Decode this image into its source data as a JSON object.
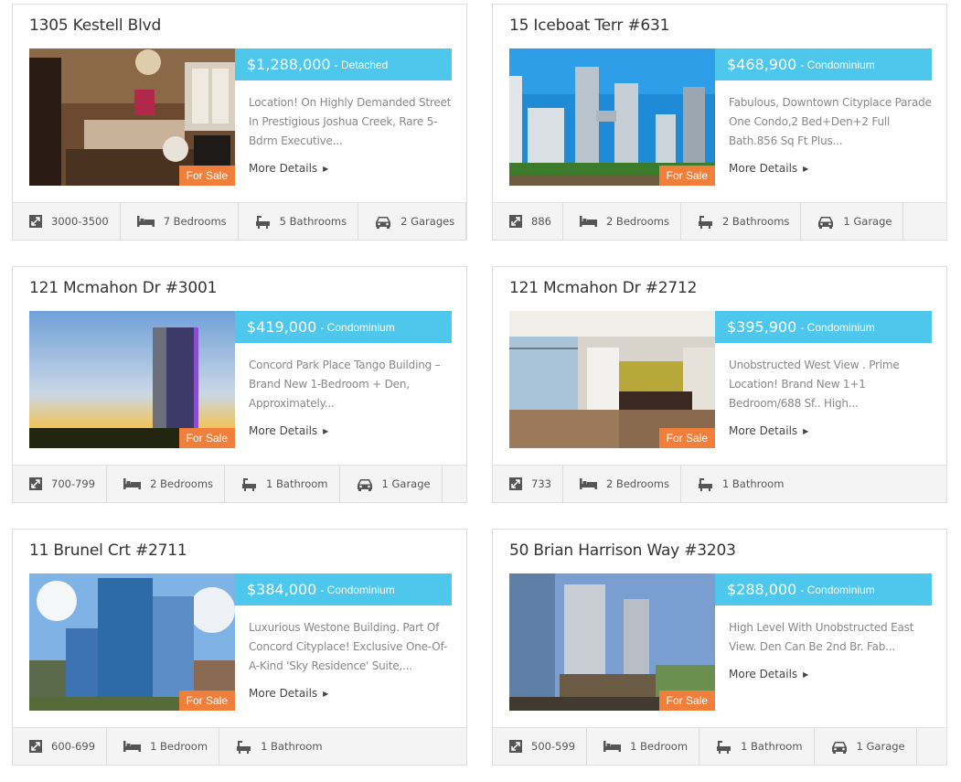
{
  "listings": [
    {
      "address": "1305 Kestell Blvd",
      "price": "$1,288,000",
      "type": "- Detached",
      "desc": "Location! On Highly Demanded Street In Prestigious Joshua Creek, Rare 5-Bdrm Executive...",
      "badge": "For Sale",
      "more": "More Details",
      "stats": [
        {
          "icon": "area-icon",
          "text": "3000-3500"
        },
        {
          "icon": "bed-icon",
          "text": "7 Bedrooms"
        },
        {
          "icon": "bath-icon",
          "text": "5 Bathrooms"
        },
        {
          "icon": "car-icon",
          "text": "2 Garages"
        }
      ]
    },
    {
      "address": "15 Iceboat Terr #631",
      "price": "$468,900",
      "type": "- Condominium",
      "desc": "Fabulous, Downtown Cityplace Parade One Condo,2 Bed+Den+2 Full Bath.856 Sq Ft Plus...",
      "badge": "For Sale",
      "more": "More Details",
      "stats": [
        {
          "icon": "area-icon",
          "text": "886"
        },
        {
          "icon": "bed-icon",
          "text": "2 Bedrooms"
        },
        {
          "icon": "bath-icon",
          "text": "2 Bathrooms"
        },
        {
          "icon": "car-icon",
          "text": "1 Garage"
        }
      ]
    },
    {
      "address": "121 Mcmahon Dr #3001",
      "price": "$419,000",
      "type": "- Condominium",
      "desc": "Concord Park Place Tango Building – Brand New 1-Bedroom + Den, Approximately...",
      "badge": "For Sale",
      "more": "More Details",
      "stats": [
        {
          "icon": "area-icon",
          "text": "700-799"
        },
        {
          "icon": "bed-icon",
          "text": "2 Bedrooms"
        },
        {
          "icon": "bath-icon",
          "text": "1 Bathroom"
        },
        {
          "icon": "car-icon",
          "text": "1 Garage"
        }
      ]
    },
    {
      "address": "121 Mcmahon Dr #2712",
      "price": "$395,900",
      "type": "- Condominium",
      "desc": "Unobstructed West View . Prime Location! Brand New 1+1 Bedroom/688 Sf.. High...",
      "badge": "For Sale",
      "more": "More Details",
      "stats": [
        {
          "icon": "area-icon",
          "text": "733"
        },
        {
          "icon": "bed-icon",
          "text": "2 Bedrooms"
        },
        {
          "icon": "bath-icon",
          "text": "1 Bathroom"
        }
      ]
    },
    {
      "address": "11 Brunel Crt #2711",
      "price": "$384,000",
      "type": "- Condominium",
      "desc": "Luxurious Westone Building. Part Of Concord Cityplace! Exclusive One-Of-A-Kind 'Sky Residence' Suite,...",
      "badge": "For Sale",
      "more": "More Details",
      "stats": [
        {
          "icon": "area-icon",
          "text": "600-699"
        },
        {
          "icon": "bed-icon",
          "text": "1 Bedroom"
        },
        {
          "icon": "bath-icon",
          "text": "1 Bathroom"
        }
      ]
    },
    {
      "address": "50 Brian Harrison Way #3203",
      "price": "$288,000",
      "type": "- Condominium",
      "desc": "High Level With Unobstructed East View. Den Can Be 2nd Br. Fab...",
      "badge": "For Sale",
      "more": "More Details",
      "stats": [
        {
          "icon": "area-icon",
          "text": "500-599"
        },
        {
          "icon": "bed-icon",
          "text": "1 Bedroom"
        },
        {
          "icon": "bath-icon",
          "text": "1 Bathroom"
        },
        {
          "icon": "car-icon",
          "text": "1 Garage"
        }
      ]
    }
  ],
  "colors": {
    "accent": "#4dc7ec",
    "badge": "#f07f3c"
  }
}
